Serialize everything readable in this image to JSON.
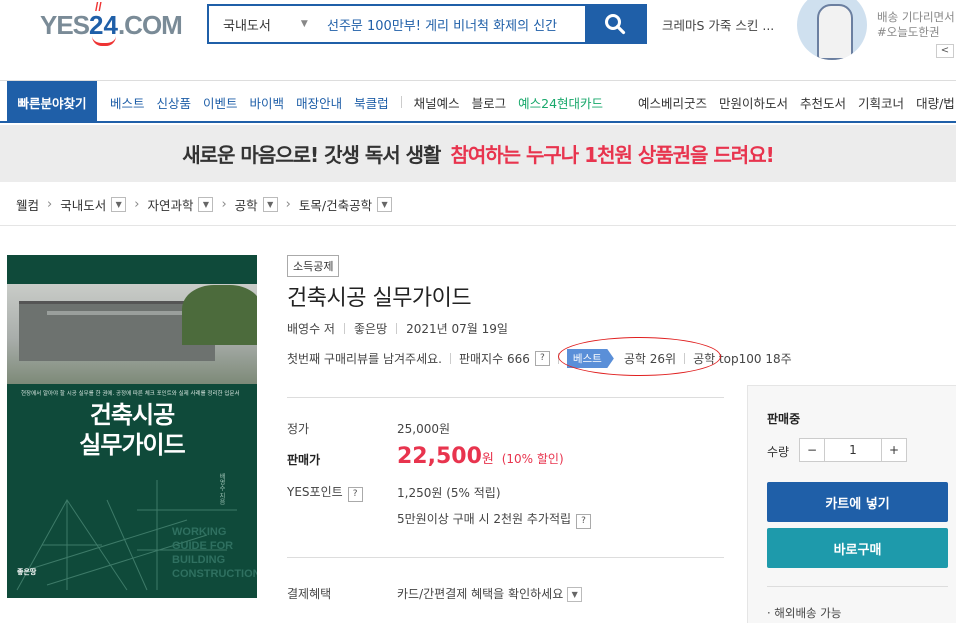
{
  "header": {
    "logo": {
      "yes": "YES",
      "n24": "24",
      "com": ".COM"
    },
    "search": {
      "category": "국내도서",
      "query": "선주문 100만부! 게리 비너척 화제의 신간"
    },
    "ad_text": "크레마S 가죽 스킨 ...",
    "promo": {
      "line1": "배송 기다리면서",
      "line2": "#오늘도한권"
    },
    "prev_label": "<"
  },
  "gnb": {
    "quick": "빠른분야찾기",
    "menu_blue": [
      "베스트",
      "신상품",
      "이벤트",
      "바이백",
      "매장안내",
      "북클럽"
    ],
    "menu_dark": [
      "채널예스",
      "블로그"
    ],
    "menu_green": "예스24현대카드",
    "menu_right": [
      "예스베리굿즈",
      "만원이하도서",
      "추천도서",
      "기획코너",
      "대량/법"
    ]
  },
  "banner": {
    "part1": "새로운 마음으로! 갓생 독서 생활",
    "part2": "참여하는 누구나 1천원 상품권을 드려요!"
  },
  "breadcrumb": [
    "웰컴",
    "국내도서",
    "자연과학",
    "공학",
    "토목/건축공학"
  ],
  "book": {
    "cover": {
      "title_line1": "건축시공",
      "title_line2": "실무가이드",
      "small_text": "현장에서 알아야 할 시공 실무를 한 권에. 공정에 따른 체크 포인트와 실제 사례를 정리한 입문서",
      "en_lines": [
        "WORKING",
        "GUIDE FOR",
        "BUILDING",
        "CONSTRUCTION"
      ],
      "author_vertical": "배영수 지음",
      "publisher_mark": "좋은땅"
    },
    "tag": "소득공제",
    "title": "건축시공 실무가이드",
    "author": "배영수 저",
    "publisher": "좋은땅",
    "date": "2021년 07월 19일",
    "review": "첫번째 구매리뷰를 남겨주세요.",
    "sales_index": "판매지수 666",
    "best_label": "베스트",
    "rank1": "공학 26위",
    "rank2": "공학 top100 18주"
  },
  "price": {
    "list_label": "정가",
    "list_value": "25,000원",
    "sale_label": "판매가",
    "sale_value": "22,500",
    "sale_won": "원",
    "discount": "(10% 할인)",
    "point_label": "YES포인트",
    "point_value": "1,250원 (5% 적립)",
    "extra_point": "5만원이상 구매 시 2천원 추가적립",
    "pay_label": "결제혜택",
    "pay_value": "카드/간편결제 혜택을 확인하세요"
  },
  "buy": {
    "status": "판매중",
    "qty_label": "수량",
    "minus": "−",
    "qty": "1",
    "plus": "+",
    "cart": "카트에 넣기",
    "buy_now": "바로구매",
    "shipping": "· 해외배송 가능"
  },
  "colors": {
    "brand": "#1f5fa8",
    "price": "#e8344e",
    "buy_now": "#1e9aab",
    "annotation": "#e02020"
  }
}
